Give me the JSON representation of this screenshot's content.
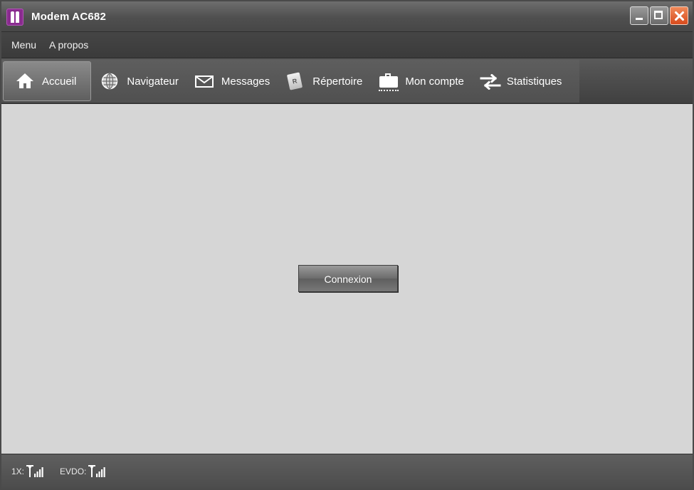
{
  "window": {
    "title": "Modem AC682"
  },
  "menu": {
    "items": [
      {
        "label": "Menu"
      },
      {
        "label": "A propos"
      }
    ]
  },
  "toolbar": {
    "items": [
      {
        "label": "Accueil",
        "icon": "home-icon",
        "active": true
      },
      {
        "label": "Navigateur",
        "icon": "globe-icon"
      },
      {
        "label": "Messages",
        "icon": "envelope-icon"
      },
      {
        "label": "Répertoire",
        "icon": "contact-card-icon",
        "icon_glyph": "R"
      },
      {
        "label": "Mon compte",
        "icon": "briefcase-icon"
      },
      {
        "label": "Statistiques",
        "icon": "transfer-arrows-icon"
      }
    ]
  },
  "main": {
    "connect_label": "Connexion"
  },
  "status": {
    "label_1x": "1X:",
    "label_evdo": "EVDO:",
    "signal_icon": "signal-strength-icon"
  },
  "colors": {
    "chrome_dark": "#4f4f4f",
    "content_bg": "#d6d6d6",
    "logo": "#8a2c8f",
    "close": "#d84a1c"
  }
}
